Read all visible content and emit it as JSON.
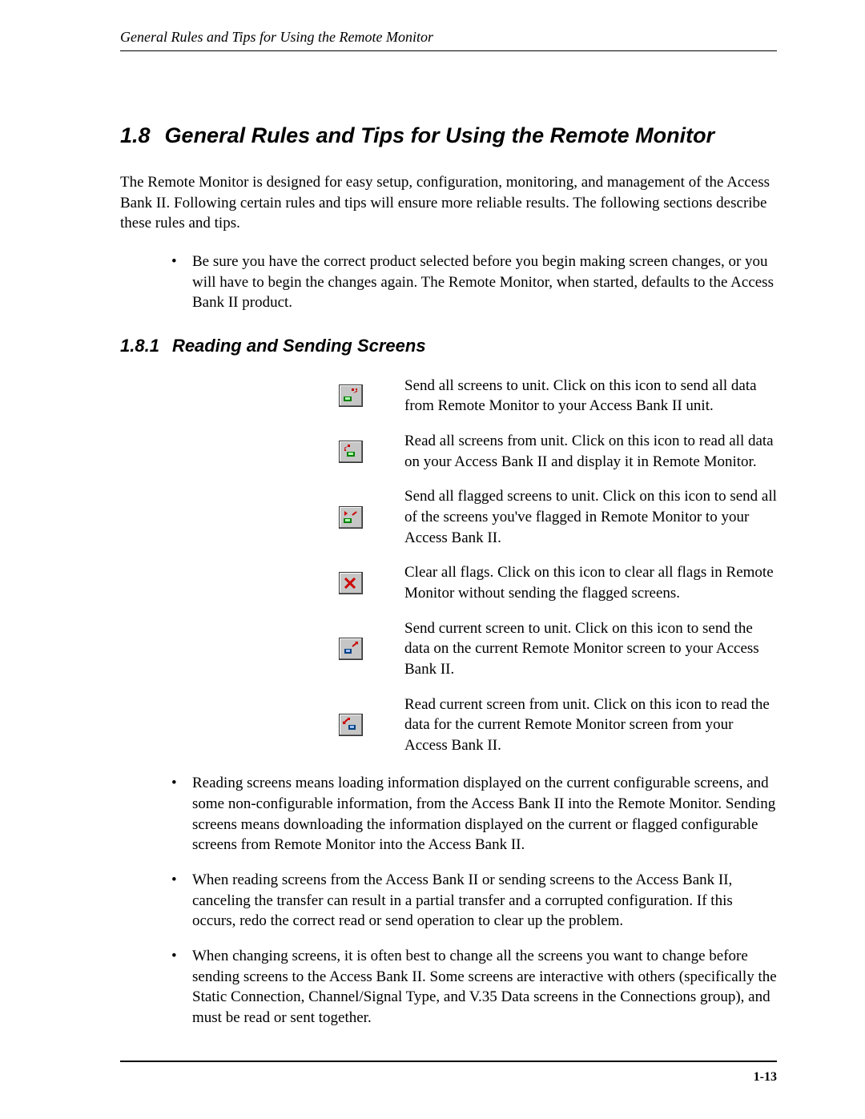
{
  "header": {
    "running_title": "General Rules and Tips for Using the Remote Monitor"
  },
  "section": {
    "number": "1.8",
    "title": "General Rules and Tips for Using the Remote Monitor",
    "intro": "The Remote Monitor is designed for easy setup, configuration, monitoring, and management of the Access Bank II. Following certain rules and tips will ensure more reliable results. The following sections describe these rules and tips.",
    "pre_bullet": "Be sure you have the correct product selected before you begin making screen changes, or you will have to begin the changes again. The Remote Monitor, when started, defaults to the Access Bank II product."
  },
  "subsection": {
    "number": "1.8.1",
    "title": "Reading and Sending Screens"
  },
  "icons": [
    {
      "name": "send-all-screens-icon",
      "desc": "Send all screens to unit. Click on this icon to send all data from Remote Monitor to your Access Bank II unit."
    },
    {
      "name": "read-all-screens-icon",
      "desc": "Read all screens from unit. Click on this icon to read all data on your Access Bank II and display it in Remote Monitor."
    },
    {
      "name": "send-flagged-screens-icon",
      "desc": "Send all flagged screens to unit. Click on this icon to send all of the screens you've flagged in Remote Monitor to your Access Bank II."
    },
    {
      "name": "clear-all-flags-icon",
      "desc": "Clear all flags. Click on this icon to clear all flags in Remote Monitor without sending the flagged screens."
    },
    {
      "name": "send-current-screen-icon",
      "desc": "Send current screen to unit. Click on this icon to send the data on the current Remote Monitor screen to your Access Bank II."
    },
    {
      "name": "read-current-screen-icon",
      "desc": "Read current screen from unit. Click on this icon to read the data for the current Remote Monitor screen from your Access Bank II."
    }
  ],
  "post_bullets": [
    "Reading screens means loading information displayed on the current configurable screens, and some non-configurable information, from the Access Bank II into the Remote Monitor. Sending screens means downloading the information displayed on the current or flagged configurable screens from Remote Monitor into the Access Bank II.",
    "When reading screens from the Access Bank II or sending screens to the Access Bank II, canceling the transfer can result in a partial transfer and a corrupted configuration. If this occurs, redo the correct read or send operation to clear up the problem.",
    "When changing screens, it is often best to change all the screens you want to change before sending screens to the Access Bank II. Some screens are interactive with others (specifically the Static Connection, Channel/Signal Type, and V.35 Data screens in the Connections group), and must be read or sent together."
  ],
  "footer": {
    "page_number": "1-13"
  }
}
